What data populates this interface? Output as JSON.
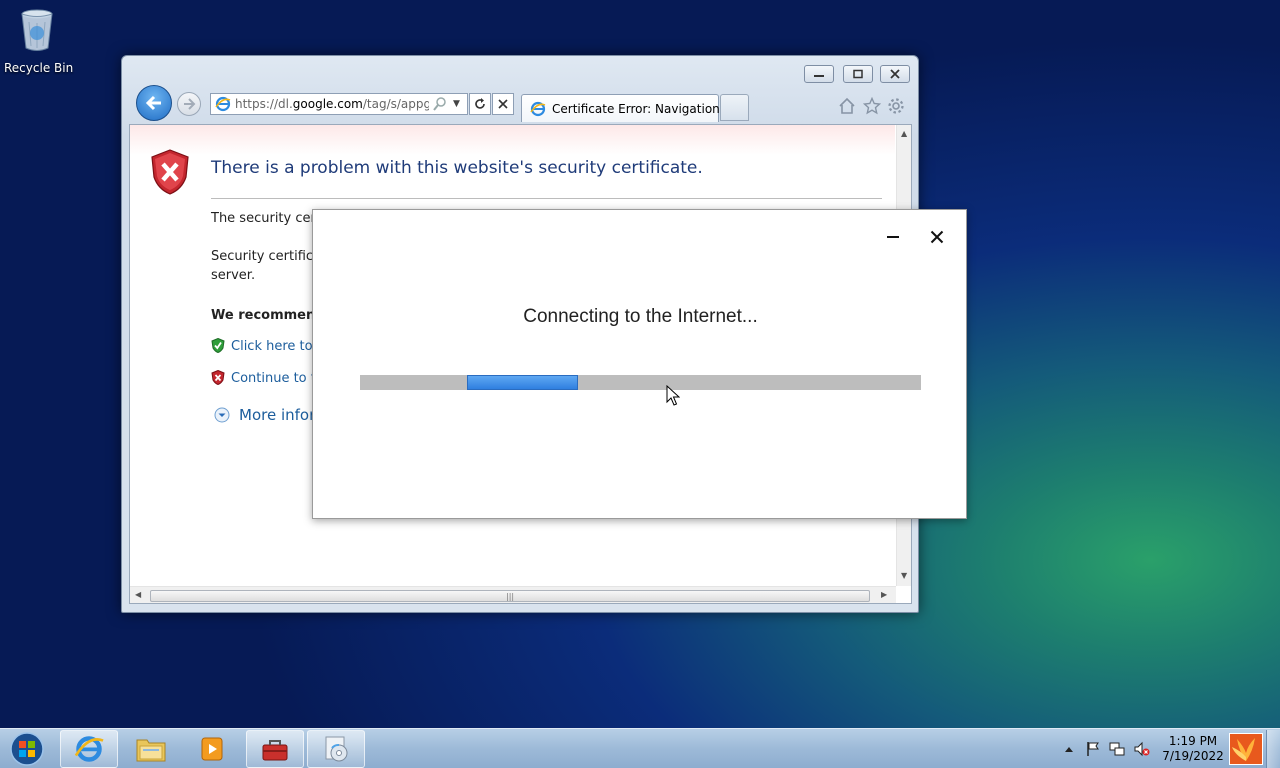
{
  "desktop": {
    "recycle_bin_label": "Recycle Bin"
  },
  "browser": {
    "address": {
      "url_prefix": "https://dl.",
      "url_domain": "google.com",
      "url_rest": "/tag/s/appgui"
    },
    "tab_title": "Certificate Error: Navigation ...",
    "page": {
      "title": "There is a problem with this website's security certificate.",
      "paragraph1": "The security certi",
      "paragraph2_line1": "Security certificat",
      "paragraph2_line2": "server.",
      "recommend": "We recommenc",
      "link_close": "Click here to c",
      "link_continue": "Continue to t",
      "more_info": "More infor"
    }
  },
  "dialog": {
    "message": "Connecting to the Internet...",
    "progress_indeterminate": true
  },
  "taskbar": {
    "pinned": [
      "internet-explorer",
      "windows-explorer",
      "media-player",
      "toolbox-app",
      "setup-app"
    ],
    "clock_time": "1:19 PM",
    "clock_date": "7/19/2022"
  },
  "colors": {
    "accent_blue": "#1c5d9c",
    "error_red": "#c4262e",
    "progress_blue": "#2f7fe0"
  }
}
